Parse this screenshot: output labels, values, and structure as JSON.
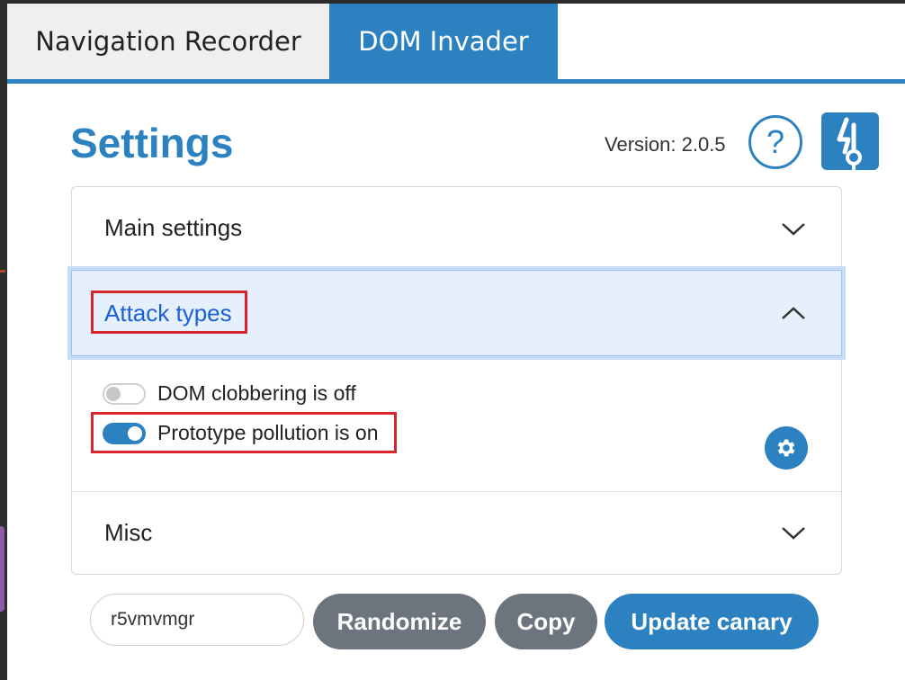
{
  "tabs": [
    {
      "label": "Navigation Recorder",
      "active": false
    },
    {
      "label": "DOM Invader",
      "active": true
    }
  ],
  "header": {
    "title": "Settings",
    "version": "Version: 2.0.5",
    "help_icon": "question-circle-icon",
    "logo_icon": "dom-invader-logo-icon"
  },
  "accordion": {
    "main_settings": {
      "label": "Main settings",
      "expanded": false
    },
    "attack_types": {
      "label": "Attack types",
      "expanded": true,
      "options": [
        {
          "label": "DOM clobbering is off",
          "enabled": false
        },
        {
          "label": "Prototype pollution is on",
          "enabled": true
        }
      ],
      "settings_icon": "gear-icon"
    },
    "misc": {
      "label": "Misc",
      "expanded": false
    }
  },
  "canary": {
    "value": "r5vmvmgr",
    "randomize_label": "Randomize",
    "copy_label": "Copy",
    "update_label": "Update canary"
  },
  "colors": {
    "accent": "#2c82c0",
    "highlight_box": "#d9262c",
    "secondary_button": "#6c757d"
  }
}
